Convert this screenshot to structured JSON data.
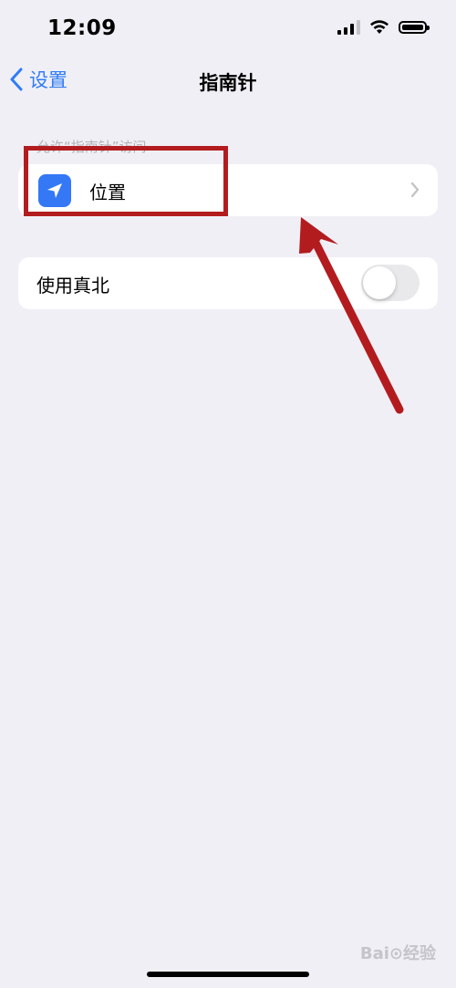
{
  "status_bar": {
    "time": "12:09",
    "icons": [
      "cellular-signal-icon",
      "wifi-icon",
      "battery-icon"
    ]
  },
  "nav": {
    "back_label": "设置",
    "title": "指南针"
  },
  "section": {
    "header": "允许“指南针”访问"
  },
  "rows": {
    "location": {
      "label": "位置",
      "icon": "location-arrow-icon"
    },
    "true_north": {
      "label": "使用真北",
      "toggle_on": false
    }
  },
  "watermark": "Bai⊙经验",
  "colors": {
    "accent": "#2f7cf6",
    "location_icon_bg": "#3478f6",
    "annotation_red": "#b31c1f",
    "background": "#f0eff5",
    "toggle_off": "#e9e9eb"
  }
}
